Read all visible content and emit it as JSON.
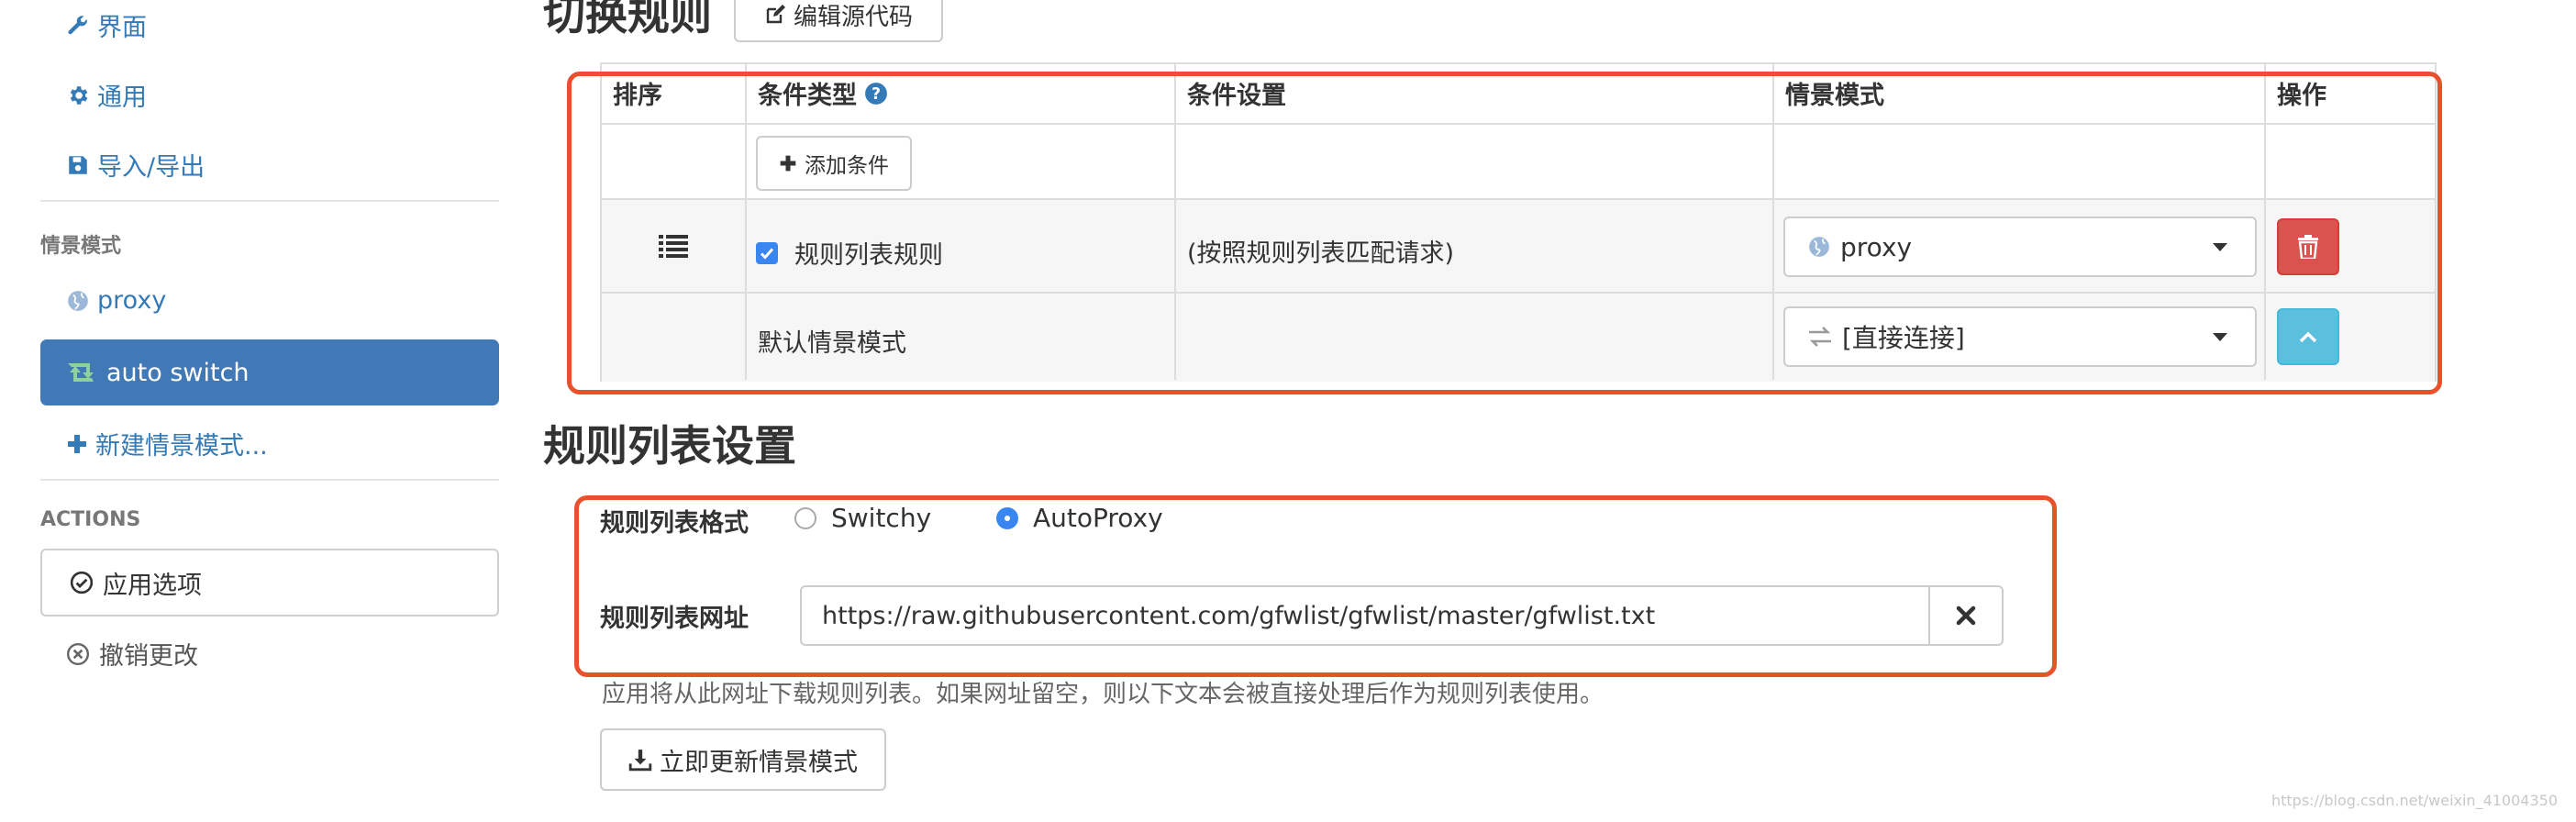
{
  "sidebar": {
    "items": [
      {
        "label": "界面",
        "icon": "wrench-icon"
      },
      {
        "label": "通用",
        "icon": "gear-icon"
      },
      {
        "label": "导入/导出",
        "icon": "save-icon"
      }
    ],
    "profiles_heading": "情景模式",
    "profiles": [
      {
        "label": "proxy",
        "icon": "globe-icon"
      },
      {
        "label": "auto switch",
        "icon": "retweet-icon",
        "active": true
      }
    ],
    "new_profile": "新建情景模式...",
    "actions_heading": "ACTIONS",
    "apply_label": "应用选项",
    "discard_label": "撤销更改"
  },
  "switch_rules": {
    "title": "切换规则",
    "edit_source_label": "编辑源代码",
    "columns": {
      "order": "排序",
      "condition_type": "条件类型",
      "condition_details": "条件设置",
      "profile": "情景模式",
      "actions": "操作"
    },
    "add_condition_label": "添加条件",
    "rule_row": {
      "condition_type": "规则列表规则",
      "checked": true,
      "condition_details": "(按照规则列表匹配请求)",
      "profile": "proxy"
    },
    "default_row": {
      "label": "默认情景模式",
      "profile": "[直接连接]"
    }
  },
  "rule_list_settings": {
    "title": "规则列表设置",
    "format_label": "规则列表格式",
    "formats": [
      {
        "label": "Switchy",
        "selected": false
      },
      {
        "label": "AutoProxy",
        "selected": true
      }
    ],
    "url_label": "规则列表网址",
    "url_value": "https://raw.githubusercontent.com/gfwlist/gfwlist/master/gfwlist.txt",
    "help_text": "应用将从此网址下载规则列表。如果网址留空，则以下文本会被直接处理后作为规则列表使用。",
    "update_label": "立即更新情景模式"
  },
  "colors": {
    "link": "#337ab7",
    "active_bg": "#4179b6",
    "highlight": "#e8512c",
    "danger": "#d9534f",
    "info": "#5bc0de",
    "radio_selected": "#3a86f1"
  },
  "watermark": "https://blog.csdn.net/weixin_41004350"
}
